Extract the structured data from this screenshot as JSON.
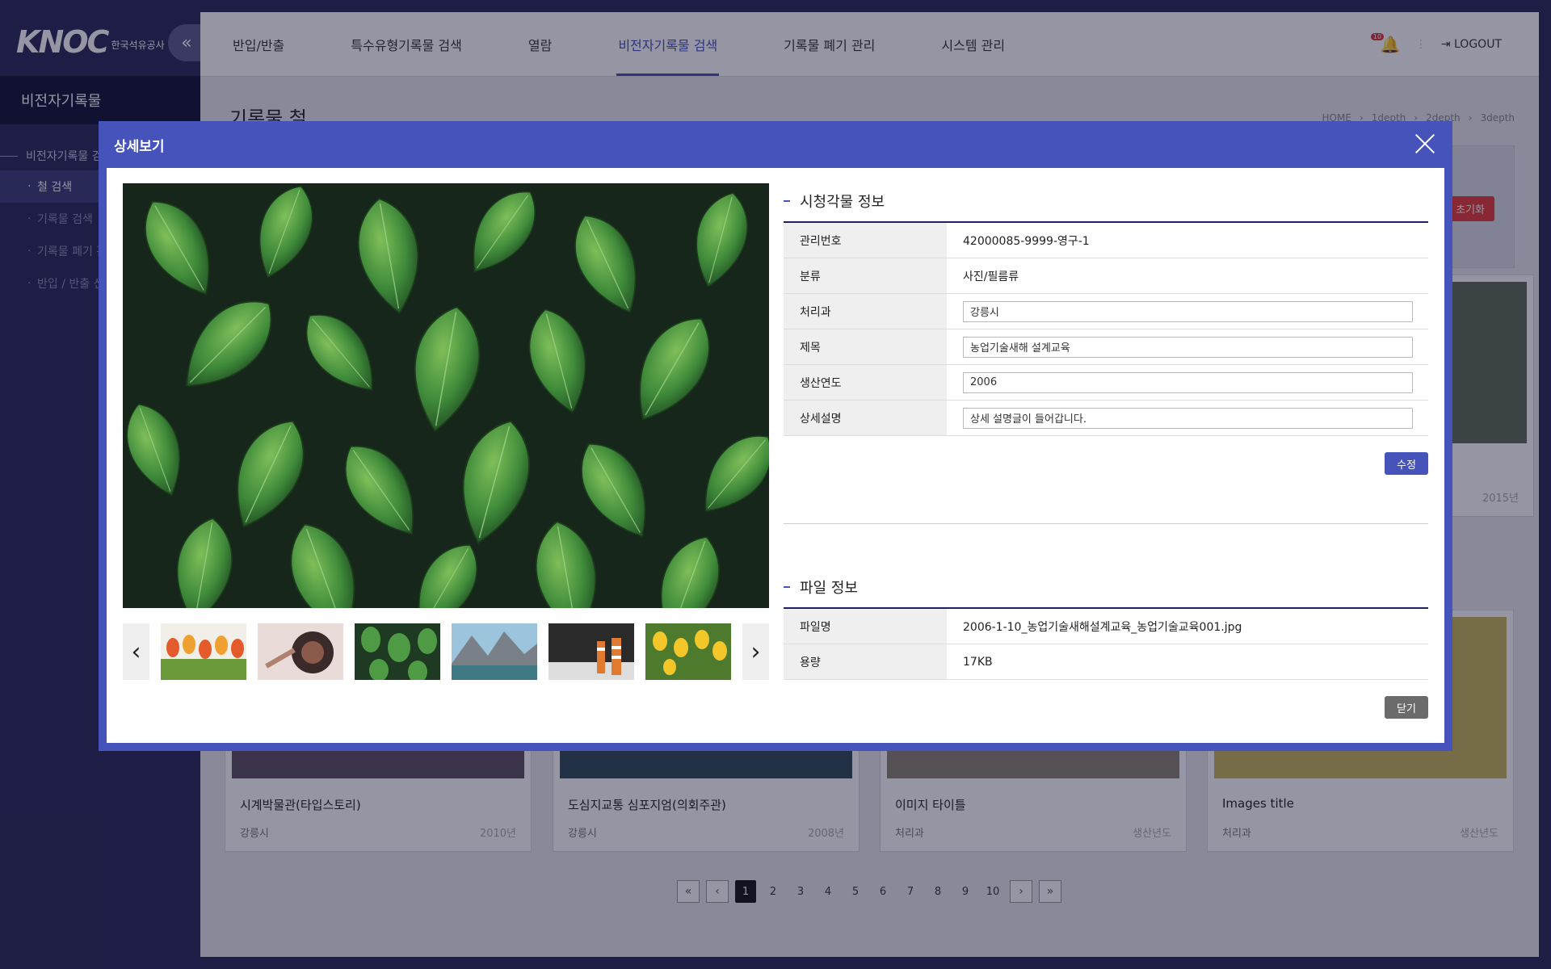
{
  "brand": {
    "logo_text": "KNOC",
    "sub_text": "한국석유공사"
  },
  "sidebar": {
    "collapse_icon": "«",
    "title": "비전자기록물",
    "group": "비전자기록물 검",
    "items": [
      {
        "label": "철 검색",
        "active": true
      },
      {
        "label": "기록물 검색"
      },
      {
        "label": "기록물 폐기 관"
      },
      {
        "label": "반입 / 반출 신"
      }
    ]
  },
  "topnav": {
    "items": [
      "반입/반출",
      "특수유형기록물 검색",
      "열람",
      "비전자기록물 검색",
      "기록물 폐기 관리",
      "시스템 관리"
    ],
    "active_index": 3,
    "notification_count": "10",
    "logout_label": "LOGOUT"
  },
  "page": {
    "title": "기록물 철",
    "breadcrumb": [
      "HOME",
      "1depth",
      "2depth",
      "3depth"
    ],
    "reset_label": "초기화"
  },
  "cards": [
    {
      "title": "시계박물관(타입스토리)",
      "dept": "강릉시",
      "year": "2010년"
    },
    {
      "title": "도심지교통 심포지엄(의회주관)",
      "dept": "강릉시",
      "year": "2008년"
    },
    {
      "title": "이미지 타이틀",
      "dept": "처리과",
      "year": "생산년도"
    },
    {
      "title": "Images title",
      "dept": "처리과",
      "year": "생산년도"
    },
    {
      "title": "",
      "dept": "",
      "year": "2015년"
    }
  ],
  "pagination": {
    "first": "«",
    "prev": "‹",
    "next": "›",
    "last": "»",
    "pages": [
      "1",
      "2",
      "3",
      "4",
      "5",
      "6",
      "7",
      "8",
      "9",
      "10"
    ],
    "current": "1"
  },
  "modal": {
    "title": "상세보기",
    "viewer": {
      "prev_icon": "‹",
      "next_icon": "›"
    },
    "info_section": {
      "title": "시청각물 정보",
      "rows": [
        {
          "label": "관리번호",
          "value": "42000085-9999-영구-1",
          "editable": false
        },
        {
          "label": "분류",
          "value": "사진/필름류",
          "editable": false
        },
        {
          "label": "처리과",
          "value": "강릉시",
          "editable": true
        },
        {
          "label": "제목",
          "value": "농업기술새해 설계교육",
          "editable": true
        },
        {
          "label": "생산연도",
          "value": "2006",
          "editable": true
        },
        {
          "label": "상세설명",
          "value": "상세 설명글이 들어갑니다.",
          "editable": true
        }
      ],
      "edit_button": "수정"
    },
    "file_section": {
      "title": "파일 정보",
      "rows": [
        {
          "label": "파일명",
          "value": "2006-1-10_농업기술새해설계교육_농업기술교육001.jpg"
        },
        {
          "label": "용량",
          "value": "17KB"
        }
      ]
    },
    "close_button": "닫기"
  },
  "colors": {
    "accent": "#4553bb",
    "sidebar": "#262654",
    "danger": "#e53935"
  }
}
